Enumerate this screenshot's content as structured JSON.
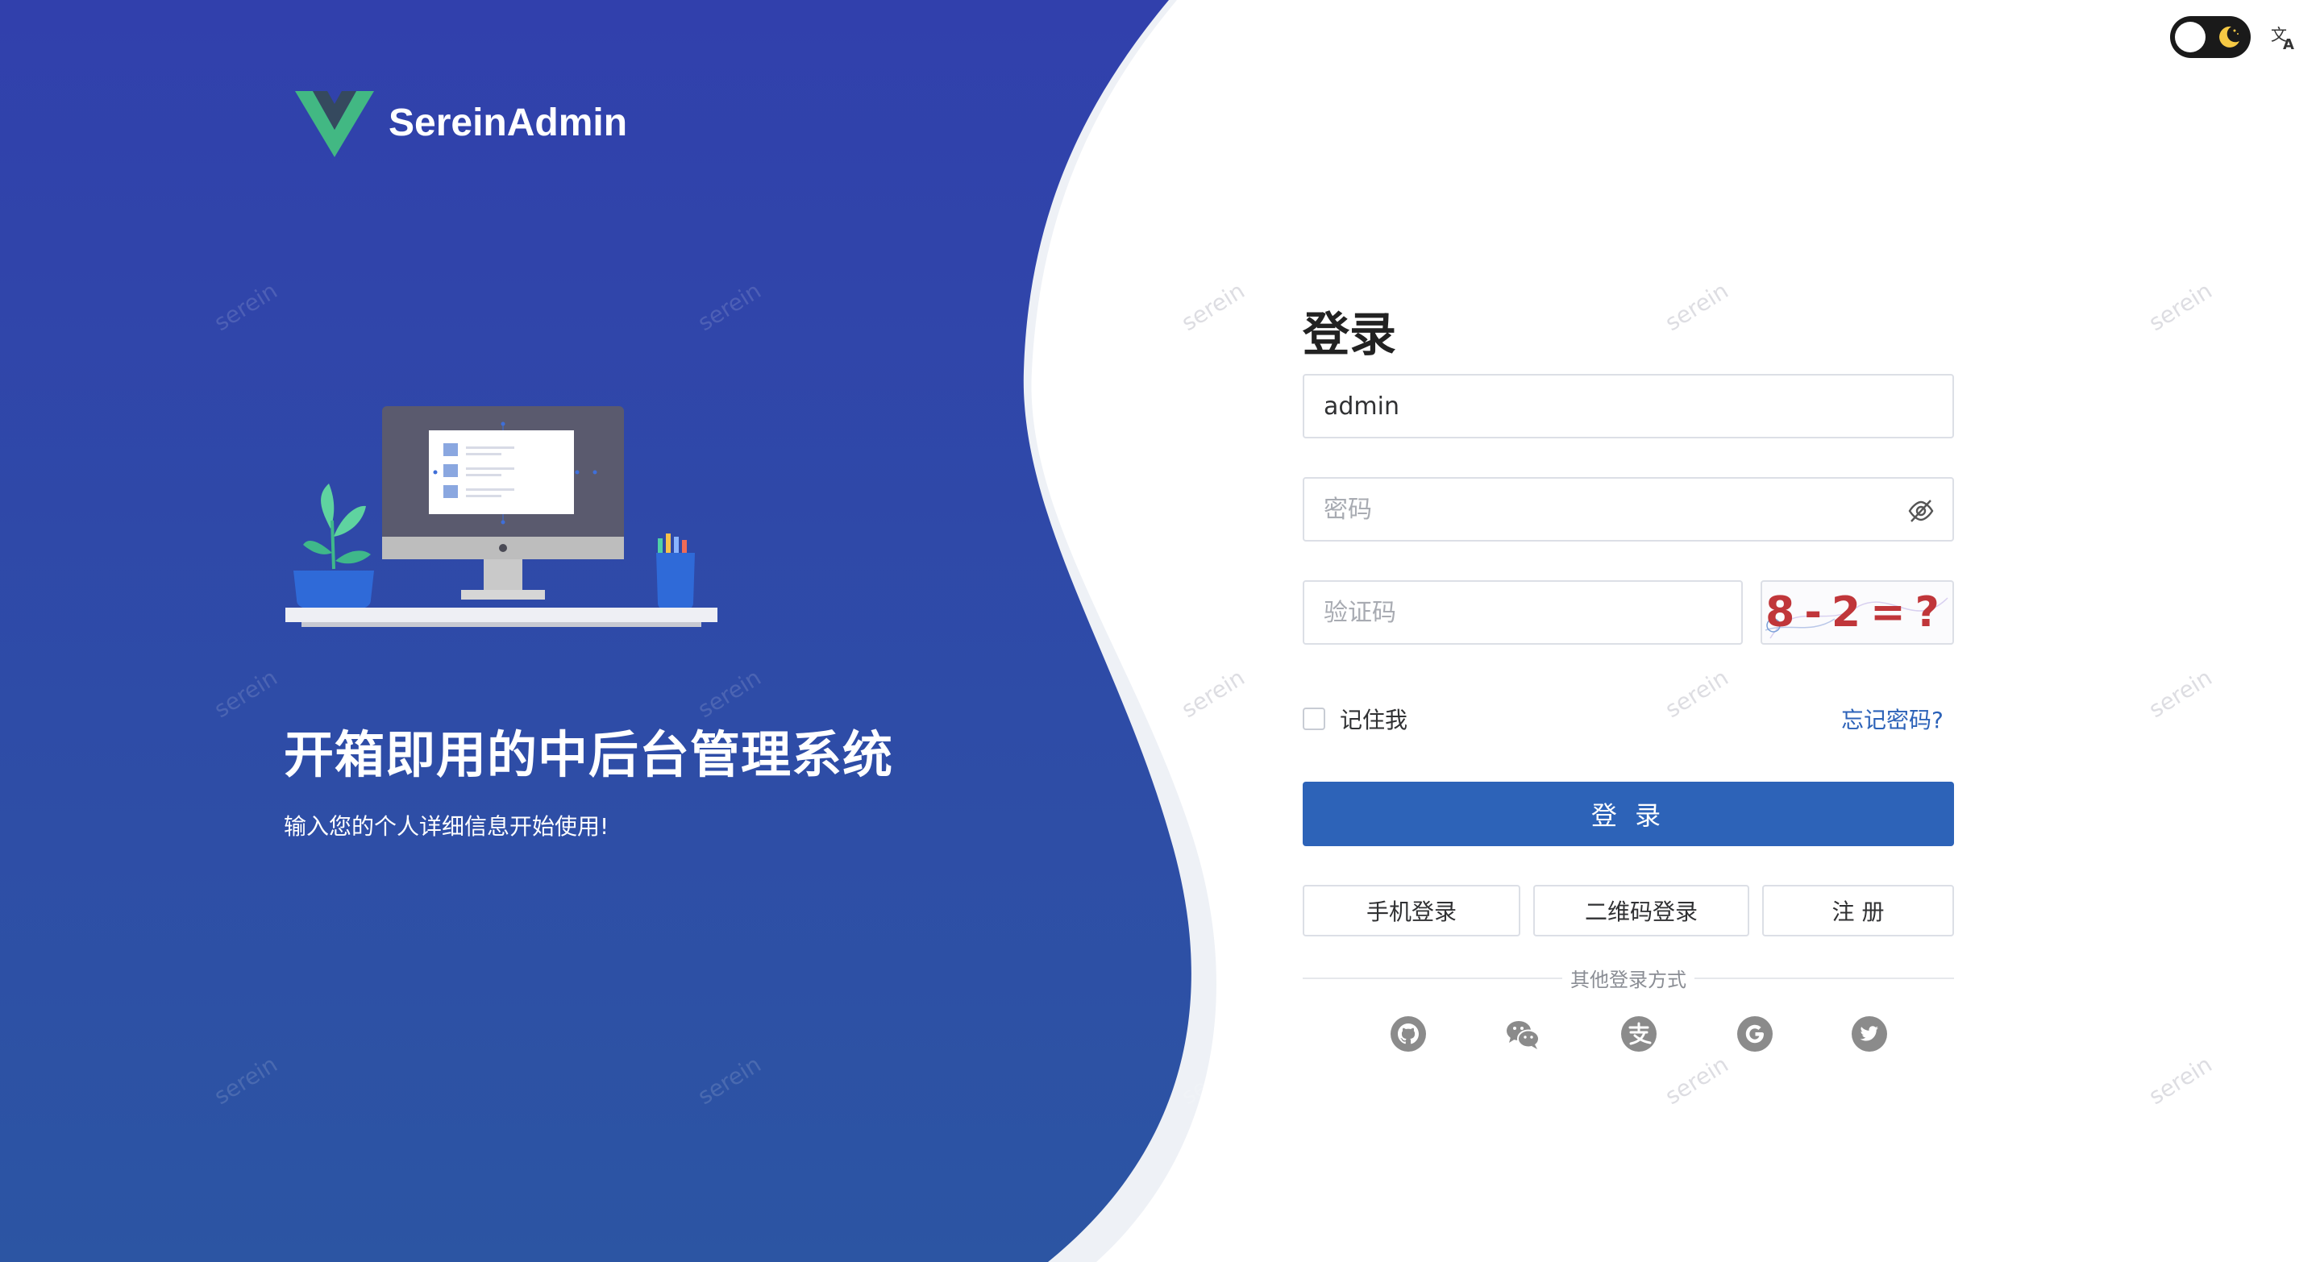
{
  "brand": {
    "name": "SereinAdmin"
  },
  "hero": {
    "title": "开箱即用的中后台管理系统",
    "subtitle": "输入您的个人详细信息开始使用!"
  },
  "header": {
    "theme_toggle_icon": "moon-icon",
    "language_icon": "translate-icon"
  },
  "watermark": "serein",
  "login": {
    "title": "登录",
    "username_value": "admin",
    "password_placeholder": "密码",
    "captcha_placeholder": "验证码",
    "captcha_text": "8-2=?",
    "remember_label": "记住我",
    "forgot_label": "忘记密码?",
    "submit_label": "登 录",
    "phone_login_label": "手机登录",
    "qr_login_label": "二维码登录",
    "register_label": "注 册",
    "other_methods_label": "其他登录方式"
  },
  "social": [
    "github-icon",
    "wechat-icon",
    "alipay-icon",
    "google-icon",
    "twitter-icon"
  ],
  "colors": {
    "primary_blue": "#2d63b8",
    "panel_blue_top": "#3140ac",
    "panel_blue_bottom": "#2c55a3",
    "icon_gray": "#8b8b8b"
  }
}
